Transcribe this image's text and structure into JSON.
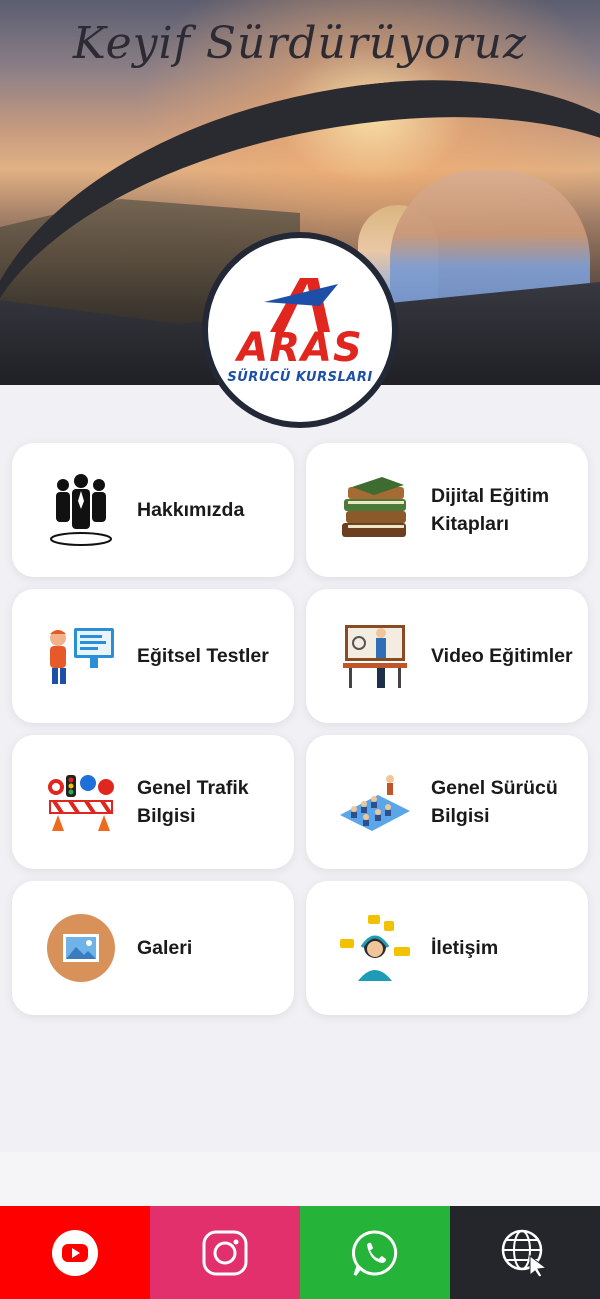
{
  "hero": {
    "slogan": "Keyif Sürdürüyoruz"
  },
  "logo": {
    "brand": "ARAS",
    "subtitle": "SÜRÜCÜ KURSLARI",
    "colors": {
      "red": "#e0261f",
      "blue": "#1e4fa8",
      "ring": "#232836"
    }
  },
  "menu": [
    {
      "label": "Hakkımızda",
      "icon": "team-icon"
    },
    {
      "label": "Dijital Eğitim Kitapları",
      "icon": "books-icon"
    },
    {
      "label": "Eğitsel Testler",
      "icon": "computer-test-icon"
    },
    {
      "label": "Video Eğitimler",
      "icon": "teacher-board-icon"
    },
    {
      "label": "Genel Trafik Bilgisi",
      "icon": "traffic-signs-icon"
    },
    {
      "label": "Genel Sürücü Bilgisi",
      "icon": "classroom-icon"
    },
    {
      "label": "Galeri",
      "icon": "gallery-icon"
    },
    {
      "label": "İletişim",
      "icon": "support-agent-icon"
    }
  ],
  "bottom_bar": [
    {
      "name": "youtube",
      "icon": "youtube-icon",
      "color": "#ff0000"
    },
    {
      "name": "instagram",
      "icon": "instagram-icon",
      "color": "#e1306c"
    },
    {
      "name": "whatsapp",
      "icon": "whatsapp-icon",
      "color": "#25b33a"
    },
    {
      "name": "website",
      "icon": "globe-icon",
      "color": "#24262b"
    }
  ]
}
